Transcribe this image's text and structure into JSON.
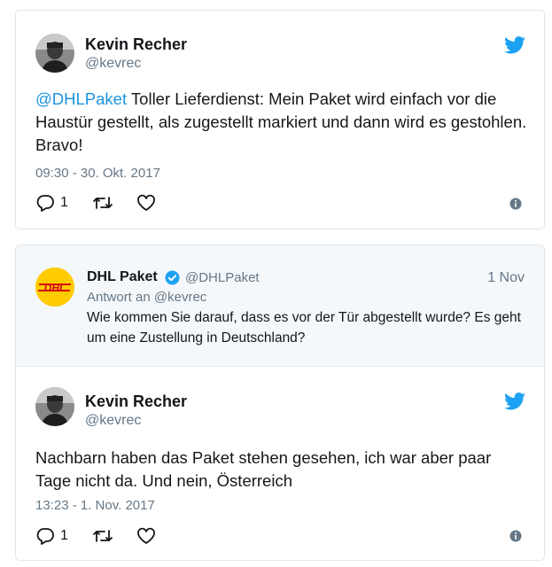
{
  "tweet1": {
    "name": "Kevin Recher",
    "handle": "@kevrec",
    "mention": "@DHLPaket",
    "text": " Toller Lieferdienst: Mein Paket wird einfach vor die Haustür gestellt, als zugestellt markiert und dann wird es gestohlen. Bravo!",
    "timestamp": "09:30 - 30. Okt. 2017",
    "reply_count": "1"
  },
  "quote": {
    "name": "DHL Paket",
    "handle": "@DHLPaket",
    "date": "1 Nov",
    "reply_prefix": "Antwort an ",
    "reply_to": "@kevrec",
    "text": "Wie kommen Sie darauf, dass es vor der Tür abgestellt wurde? Es geht um eine Zustellung in Deutschland?",
    "logo_text": "DHL"
  },
  "tweet2": {
    "name": "Kevin Recher",
    "handle": "@kevrec",
    "text": "Nachbarn haben das Paket stehen gesehen, ich war aber paar Tage nicht da. Und nein, Österreich",
    "timestamp": "13:23 - 1. Nov. 2017",
    "reply_count": "1"
  },
  "colors": {
    "link": "#1b95e0",
    "muted": "#657786",
    "dhl_yellow": "#ffcc00",
    "dhl_red": "#d40511",
    "border": "#e1e8ed"
  },
  "icons": [
    "twitter-bird-icon",
    "reply-icon",
    "retweet-icon",
    "like-icon",
    "info-icon",
    "verified-badge-icon"
  ]
}
